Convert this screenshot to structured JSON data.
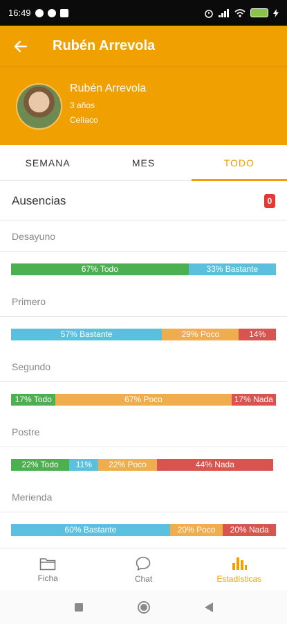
{
  "status_bar": {
    "time": "16:49"
  },
  "app_bar": {
    "title": "Rubén Arrevola"
  },
  "profile": {
    "name": "Rubén Arrevola",
    "age": "3 años",
    "diet": "Celíaco"
  },
  "tabs": [
    {
      "label": "SEMANA",
      "active": false
    },
    {
      "label": "MES",
      "active": false
    },
    {
      "label": "TODO",
      "active": true
    }
  ],
  "ausencias": {
    "label": "Ausencias",
    "count": "0"
  },
  "meals": [
    {
      "name": "Desayuno",
      "segments": [
        {
          "label": "67% Todo",
          "percent": 67,
          "category": "todo"
        },
        {
          "label": "33% Bastante",
          "percent": 33,
          "category": "bastante"
        }
      ]
    },
    {
      "name": "Primero",
      "segments": [
        {
          "label": "57% Bastante",
          "percent": 57,
          "category": "bastante"
        },
        {
          "label": "29% Poco",
          "percent": 29,
          "category": "poco"
        },
        {
          "label": "14%",
          "percent": 14,
          "category": "nada"
        }
      ]
    },
    {
      "name": "Segundo",
      "segments": [
        {
          "label": "17% Todo",
          "percent": 17,
          "category": "todo"
        },
        {
          "label": "67% Poco",
          "percent": 67,
          "category": "poco"
        },
        {
          "label": "17% Nada",
          "percent": 17,
          "category": "nada"
        }
      ]
    },
    {
      "name": "Postre",
      "segments": [
        {
          "label": "22% Todo",
          "percent": 22,
          "category": "todo"
        },
        {
          "label": "11%",
          "percent": 11,
          "category": "bastante"
        },
        {
          "label": "22% Poco",
          "percent": 22,
          "category": "poco"
        },
        {
          "label": "44% Nada",
          "percent": 44,
          "category": "nada"
        }
      ]
    },
    {
      "name": "Merienda",
      "segments": [
        {
          "label": "60% Bastante",
          "percent": 60,
          "category": "bastante"
        },
        {
          "label": "20% Poco",
          "percent": 20,
          "category": "poco"
        },
        {
          "label": "20% Nada",
          "percent": 20,
          "category": "nada"
        }
      ]
    }
  ],
  "bottom_nav": [
    {
      "label": "Ficha",
      "icon": "folder-icon",
      "active": false
    },
    {
      "label": "Chat",
      "icon": "chat-icon",
      "active": false
    },
    {
      "label": "Estadísticas",
      "icon": "stats-icon",
      "active": true
    }
  ],
  "colors": {
    "primary": "#f0a000",
    "todo": "#4caf50",
    "bastante": "#5bc0de",
    "poco": "#f0ad4e",
    "nada": "#d9534f",
    "badge": "#e53935"
  }
}
